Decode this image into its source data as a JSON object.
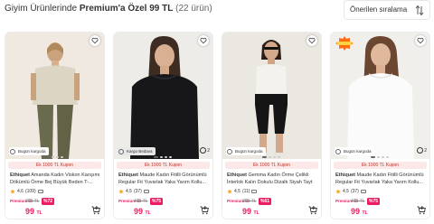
{
  "header": {
    "title_prefix": "Giyim Ürünlerinde",
    "title_bold": "Premium'a Özel 99 TL",
    "count": "(22 ürün)",
    "sort_label": "Önerilen sıralama"
  },
  "colors": {
    "accent": "#e91e63",
    "coupon_bg": "#fde8e8",
    "coupon_text": "#c0392b"
  },
  "products": [
    {
      "brand": "Ethiquet",
      "name": "Amanda Kadın Viskon Karışımı Dökümlü Örme Bej Büyük Beden T-...",
      "shipping": "Bugün kargoda",
      "coupon": "Ek 1000 TL Kupon",
      "rating": "4,6",
      "reviews": "(109)",
      "premium_label": "Premium ile",
      "old_price": "200 TL",
      "discount": "%72",
      "price": "99",
      "currency": "TL",
      "compare": ""
    },
    {
      "brand": "Ethiquet",
      "name": "Maude Kadın Fitilli Görünümlü Regular Fit Yuvarlak Yaka Yarım Kollu...",
      "shipping": "Kargo Bedava",
      "coupon": "Ek 1000 TL Kupon",
      "rating": "4,5",
      "reviews": "(37)",
      "premium_label": "Premium ile",
      "old_price": "400 TL",
      "discount": "%75",
      "price": "99",
      "currency": "TL",
      "compare": "2"
    },
    {
      "brand": "Ethiquet",
      "name": "Gemma Kadın Örme Çelikli İnterlok Kalın Dokulu Dizaltı Siyah Tayt",
      "shipping": "Bugün kargoda",
      "coupon": "Ek 1000 TL Kupon",
      "rating": "4,5",
      "reviews": "(11)",
      "premium_label": "Premium ile",
      "old_price": "250 TL",
      "discount": "%61",
      "price": "99",
      "currency": "TL",
      "compare": ""
    },
    {
      "brand": "Ethiquet",
      "name": "Maude Kadın Fitilli Görünümlü Regular Fit Yuvarlak Yaka Yarım Kollu...",
      "shipping": "Bugün kargoda",
      "coupon": "Ek 1000 TL Kupon",
      "rating": "4,5",
      "reviews": "(37)",
      "premium_label": "Premium ile",
      "old_price": "400 TL",
      "discount": "%75",
      "price": "99",
      "currency": "TL",
      "compare": "2"
    }
  ]
}
